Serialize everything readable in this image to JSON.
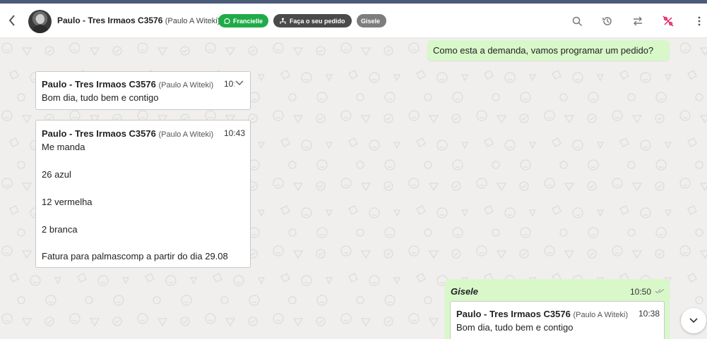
{
  "header": {
    "contact_name": "Paulo - Tres Irmaos C3576",
    "contact_sub": "(Paulo A Witeki)",
    "tags": [
      {
        "label": "Francielle",
        "icon": "whatsapp-icon",
        "color": "#1fab48"
      },
      {
        "label": "Faça o seu pedido",
        "icon": "network-icon",
        "color": "#4a4a4a"
      },
      {
        "label": "Gisele",
        "color": "#7d7d7d"
      }
    ],
    "actions": [
      "search-icon",
      "history-icon",
      "transfer-icon",
      "percent-off-icon",
      "more-vertical-icon"
    ]
  },
  "messages": {
    "out1": {
      "text": "Como esta a demanda, vamos programar um pedido?"
    },
    "in1": {
      "name": "Paulo - Tres Irmaos C3576",
      "sub": "(Paulo A Witeki)",
      "time": "10:",
      "text": "Bom dia, tudo bem e contigo"
    },
    "in2": {
      "name": "Paulo - Tres Irmaos C3576",
      "sub": "(Paulo A Witeki)",
      "time": "10:43",
      "lines": [
        "Me manda",
        "26 azul",
        "12 vermelha",
        "2 branca",
        "Fatura para palmascomp a partir do dia 29.08"
      ]
    },
    "out2": {
      "author": "Gisele",
      "time": "10:50",
      "quote": {
        "name": "Paulo - Tres Irmaos C3576",
        "sub": "(Paulo A Witeki)",
        "time": "10:38",
        "text": "Bom dia, tudo bem e contigo"
      }
    }
  },
  "colors": {
    "accent_green": "#1fab48",
    "outgoing_bubble": "#d8f8c9",
    "header_stripe": "#4c5b7a",
    "alert_red": "#e0245e"
  }
}
